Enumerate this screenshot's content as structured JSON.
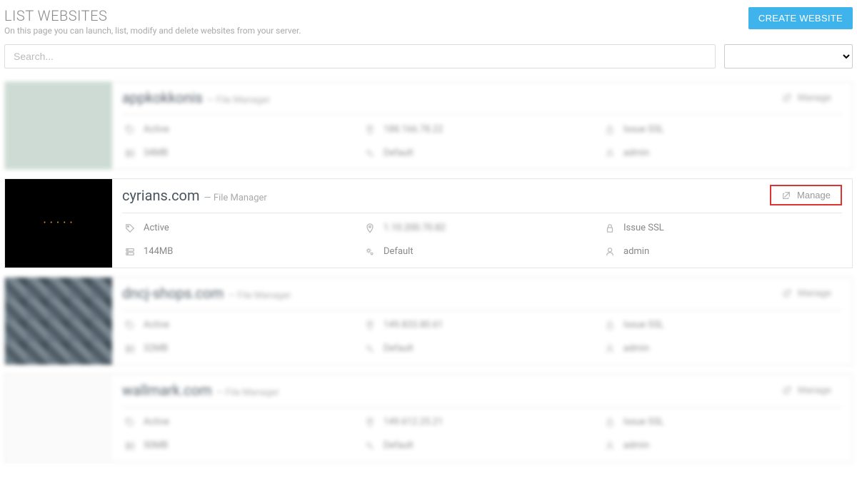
{
  "header": {
    "title": "LIST WEBSITES",
    "subtitle": "On this page you can launch, list, modify and delete websites from your server.",
    "create_button": "CREATE WEBSITE"
  },
  "search": {
    "placeholder": "Search...",
    "value": "",
    "dropdown_value": ""
  },
  "cards": [
    {
      "domain": "appkokkonis",
      "fm": "— File Manager",
      "manage": "Manage",
      "status": "Active",
      "ip": "188.166.78.22",
      "ssl": "Issue SSL",
      "size": "34MB",
      "package": "Default",
      "user": "admin",
      "blurred": true,
      "thumb_class": "greenish",
      "highlight_manage": false
    },
    {
      "domain": "cyrians.com",
      "fm": "— File Manager",
      "manage": "Manage",
      "status": "Active",
      "ip": "1.10.200.70.82",
      "ssl": "Issue SSL",
      "size": "144MB",
      "package": "Default",
      "user": "admin",
      "blurred": false,
      "thumb_class": "dark",
      "highlight_manage": true
    },
    {
      "domain": "dncj-shops.com",
      "fm": "— File Manager",
      "manage": "Manage",
      "status": "Active",
      "ip": "149.833.80.61",
      "ssl": "Issue SSL",
      "size": "32MB",
      "package": "Default",
      "user": "admin",
      "blurred": true,
      "thumb_class": "mosaic",
      "highlight_manage": false
    },
    {
      "domain": "wallmark.com",
      "fm": "— File Manager",
      "manage": "Manage",
      "status": "Active",
      "ip": "149.612.25.21",
      "ssl": "Issue SSL",
      "size": "50MB",
      "package": "Default",
      "user": "admin",
      "blurred": true,
      "thumb_class": "white",
      "highlight_manage": false
    }
  ]
}
